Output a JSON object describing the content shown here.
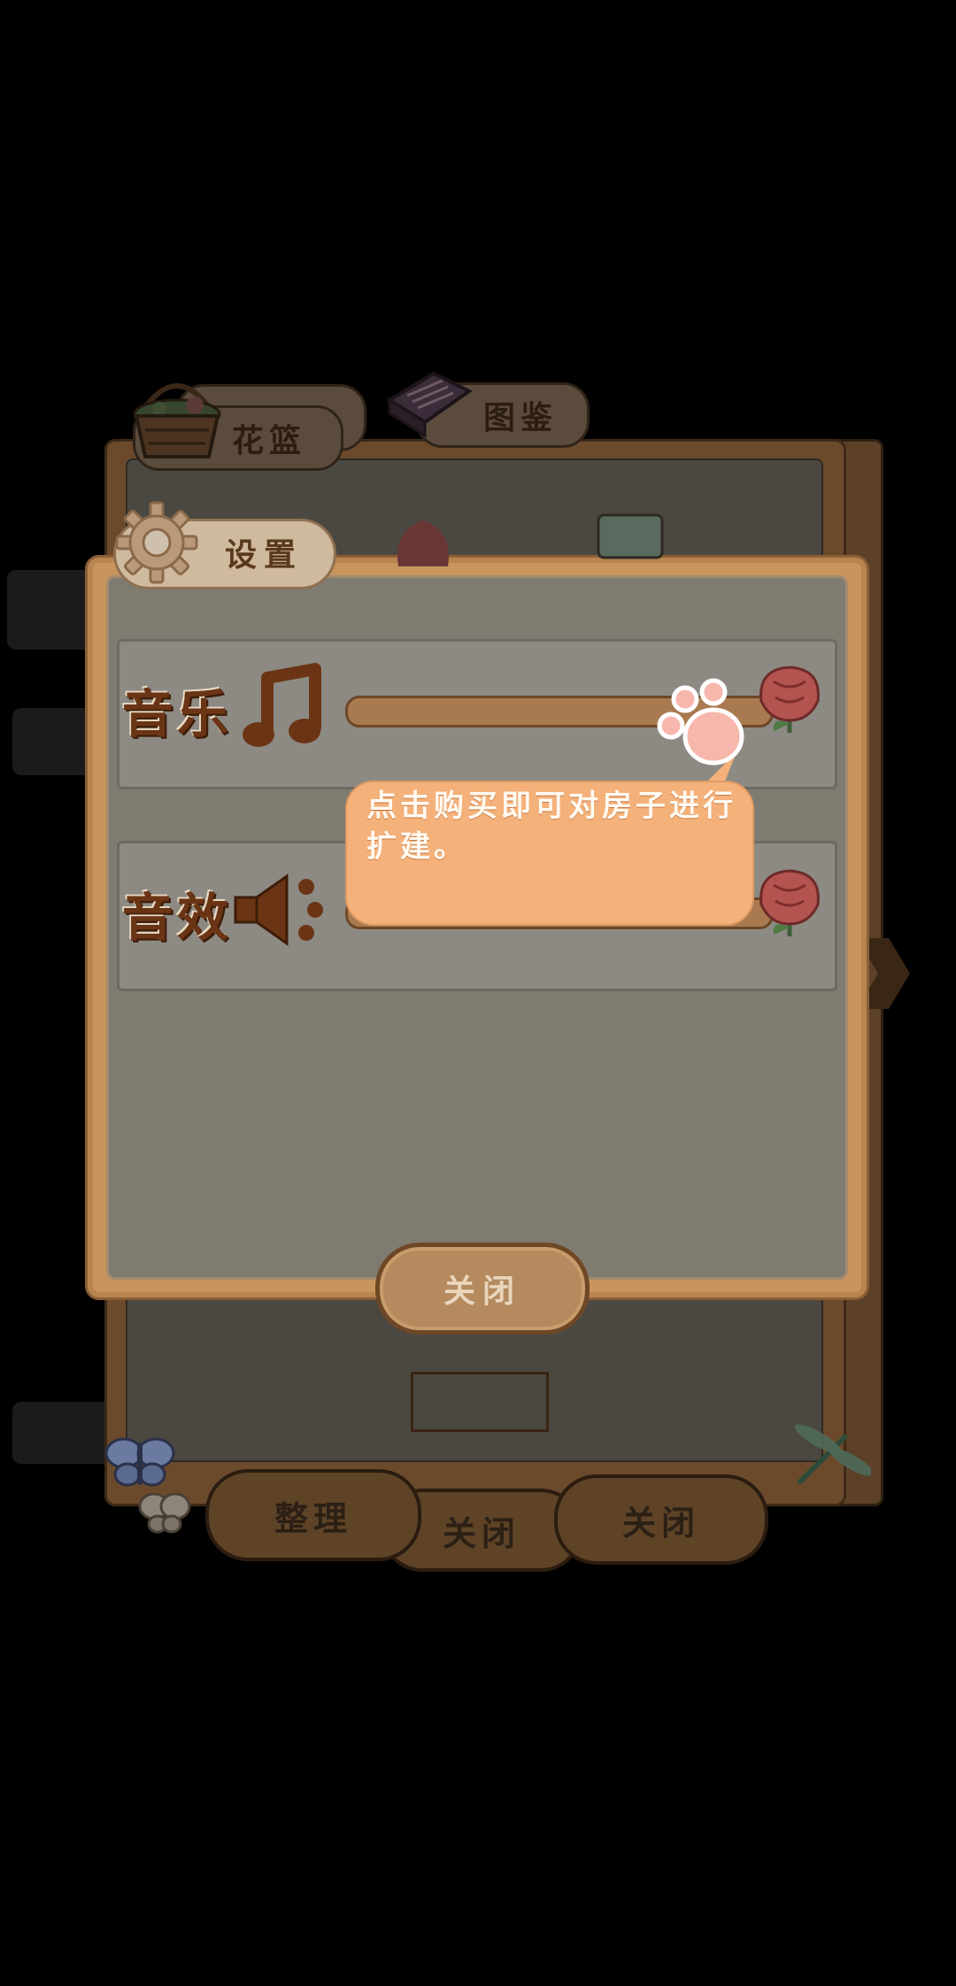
{
  "background_window": {
    "tabs": [
      {
        "label": "花篮",
        "icon": "flower-basket-icon"
      },
      {
        "label": "图鉴",
        "icon": "book-icon"
      }
    ],
    "buttons": {
      "organize": "整理",
      "close_center": "关闭",
      "close_right": "关闭"
    }
  },
  "settings": {
    "tab_label": "设置",
    "rows": [
      {
        "label": "音乐",
        "icon": "music-note-icon",
        "volume": 1.0
      },
      {
        "label": "音效",
        "icon": "speaker-icon",
        "volume": 1.0
      }
    ],
    "close_label": "关闭"
  },
  "tutorial": {
    "text": "点击购买即可对房子进行扩建。"
  },
  "colors": {
    "frame": "#c8955e",
    "inner": "#7f7b70",
    "bubble": "#f5b17a",
    "label": "#6b3515"
  }
}
